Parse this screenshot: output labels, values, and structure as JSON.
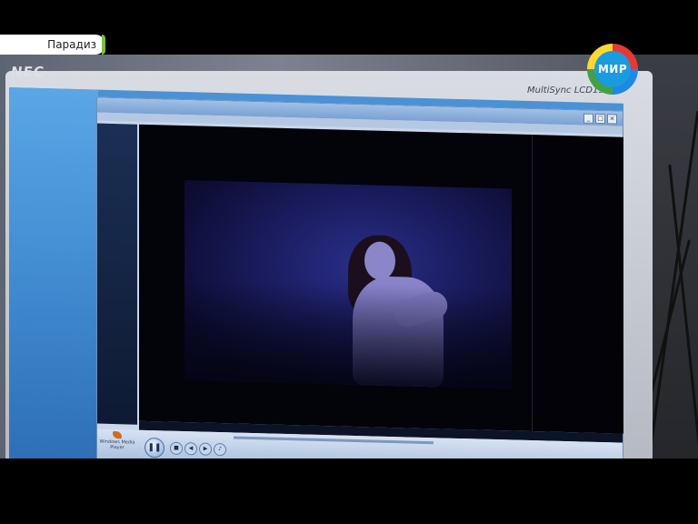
{
  "overlay": {
    "show_title": "Парадиз",
    "channel_logo_text": "МИР"
  },
  "monitor": {
    "brand": "NEC",
    "model": "MultiSync LCD1970"
  },
  "player": {
    "logo_text": "Windows Media Player"
  },
  "colors": {
    "channel_tag_accent": "#7bbf3a",
    "logo_ring": [
      "#e53935",
      "#1e88e5",
      "#43a047",
      "#fdd835"
    ],
    "logo_center": "#1a9be0"
  }
}
